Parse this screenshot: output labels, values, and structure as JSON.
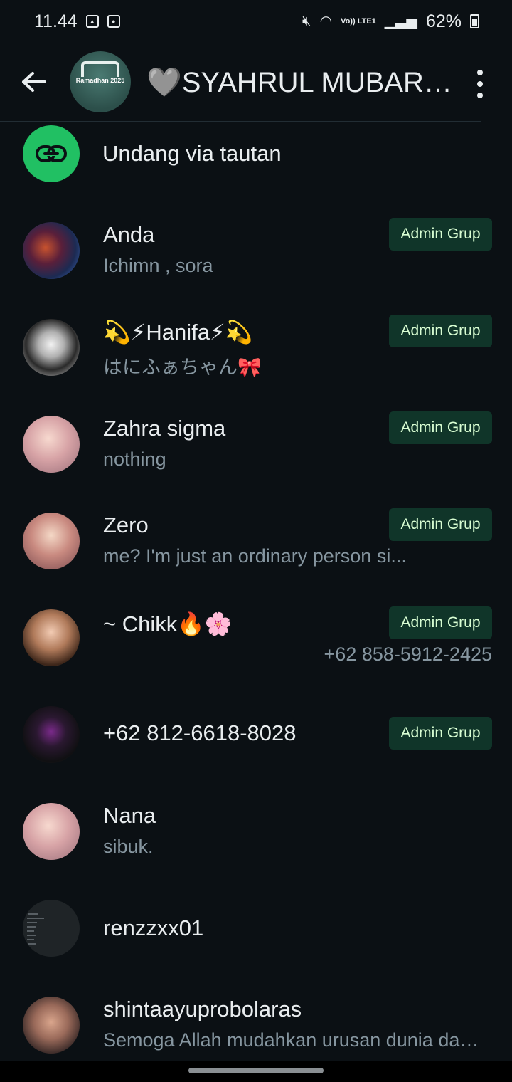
{
  "status_bar": {
    "time": "11.44",
    "battery": "62%",
    "network": "Vo)) LTE1",
    "icons": [
      "image-icon",
      "screen-record-icon",
      "mute-icon",
      "wifi-icon",
      "signal-icon",
      "battery-icon"
    ]
  },
  "header": {
    "title": "🩶SYAHRUL MUBARAK 🩶",
    "avatar_text": "Ramadhan 2025"
  },
  "invite": {
    "label": "Undang via tautan",
    "accent": "#21c063"
  },
  "members": [
    {
      "name": "Anda",
      "about": "Ichimn , sora",
      "badge": "Admin Grup",
      "phone": ""
    },
    {
      "name": "💫⚡Hanifa⚡💫",
      "about": "はにふぁちゃん🎀",
      "badge": "Admin Grup",
      "phone": ""
    },
    {
      "name": "Zahra sigma",
      "about": "nothing",
      "badge": "Admin Grup",
      "phone": ""
    },
    {
      "name": "Zero",
      "about": "me? I'm just an ordinary person               si...",
      "badge": "Admin Grup",
      "phone": ""
    },
    {
      "name": "~ Chikk🔥🌸",
      "about": "",
      "badge": "Admin Grup",
      "phone": "+62 858-5912-2425"
    },
    {
      "name": "+62 812-6618-8028",
      "about": "",
      "badge": "Admin Grup",
      "phone": ""
    },
    {
      "name": "Nana",
      "about": "sibuk.",
      "badge": "",
      "phone": ""
    },
    {
      "name": "renzzxx01",
      "about": "",
      "badge": "",
      "phone": ""
    },
    {
      "name": "shintaayuprobolaras",
      "about": "Semoga Allah mudahkan urusan dunia dan akhirat kita",
      "badge": "",
      "phone": ""
    }
  ],
  "colors": {
    "background": "#0b1014",
    "badge_bg": "#103529",
    "badge_text": "#d8fdd2",
    "secondary_text": "#8696a0"
  }
}
